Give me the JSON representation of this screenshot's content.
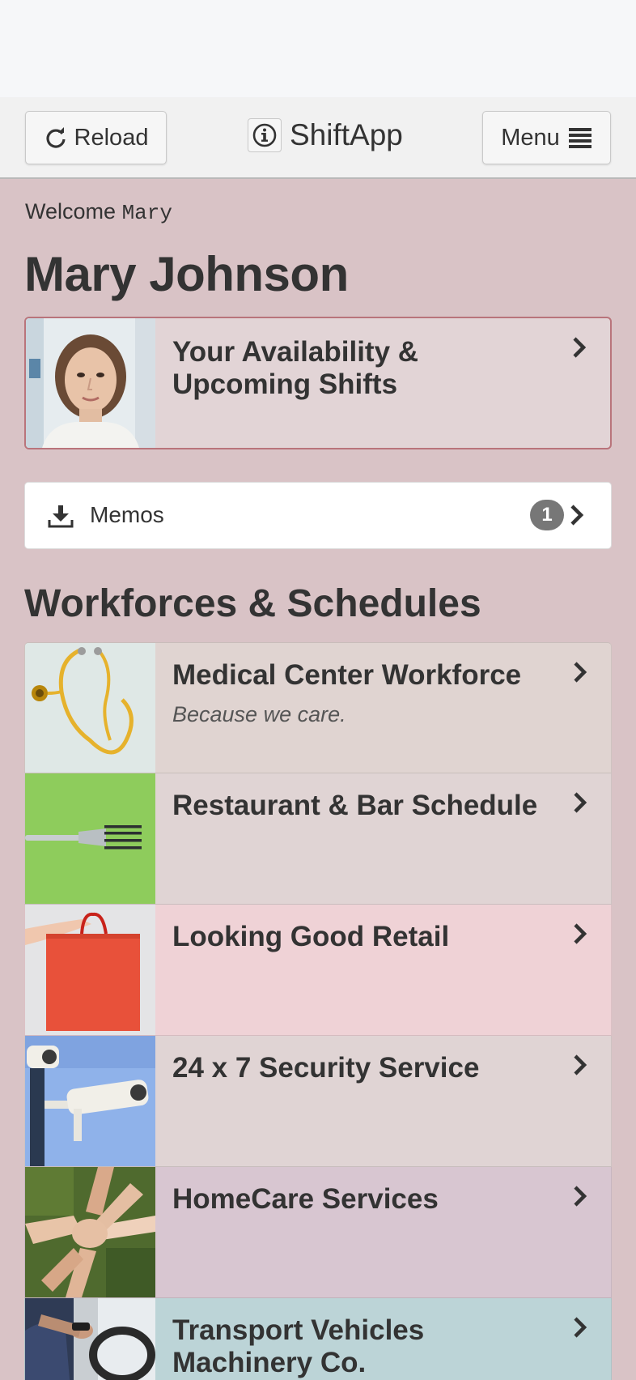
{
  "header": {
    "reload_label": "Reload",
    "brand": "ShiftApp",
    "menu_label": "Menu"
  },
  "welcome": {
    "prefix": "Welcome",
    "username": "Mary"
  },
  "user": {
    "full_name": "Mary Johnson"
  },
  "availability_card": {
    "title": "Your Availability & Upcoming Shifts"
  },
  "memos": {
    "label": "Memos",
    "count": "1"
  },
  "section": {
    "title": "Workforces & Schedules"
  },
  "workforces": [
    {
      "title": "Medical Center Workforce",
      "subtitle": "Because we care.",
      "color": "#e0d4d1",
      "icon": "stethoscope-image"
    },
    {
      "title": "Restaurant & Bar Schedule",
      "subtitle": "",
      "color": "#e0d4d4",
      "icon": "fork-image"
    },
    {
      "title": "Looking Good Retail",
      "subtitle": "",
      "color": "#efd2d6",
      "icon": "shopping-bag-image"
    },
    {
      "title": "24 x 7 Security Service",
      "subtitle": "",
      "color": "#e0d4d4",
      "icon": "security-camera-image"
    },
    {
      "title": "HomeCare Services",
      "subtitle": "",
      "color": "#d8c6d1",
      "icon": "joined-hands-image"
    },
    {
      "title": "Transport Vehicles Machinery Co.",
      "subtitle": "",
      "color": "#bcd4d7",
      "icon": "driver-image"
    }
  ]
}
